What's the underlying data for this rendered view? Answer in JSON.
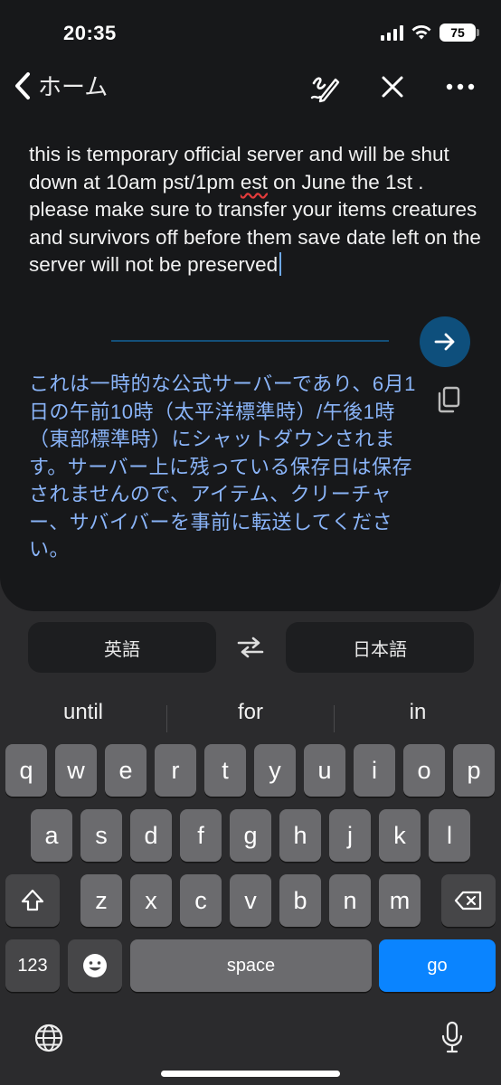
{
  "status_bar": {
    "time": "20:35",
    "battery": "75"
  },
  "nav": {
    "back_label": "ホーム"
  },
  "source": {
    "text_before": "this is temporary official server and will be shut down at 10am pst/1pm ",
    "spell_word": "est",
    "text_after": " on June the 1st . please make sure to transfer your items creatures and survivors off before them save date left on the server will not be preserved"
  },
  "translation": {
    "text": "これは一時的な公式サーバーであり、6月1日の午前10時（太平洋標準時）/午後1時（東部標準時）にシャットダウンされます。サーバー上に残っている保存日は保存されませんので、アイテム、クリーチャー、サバイバーを事前に転送してください。"
  },
  "languages": {
    "source": "英語",
    "target": "日本語"
  },
  "keyboard": {
    "suggestions": [
      "until",
      "for",
      "in"
    ],
    "row1": [
      "q",
      "w",
      "e",
      "r",
      "t",
      "y",
      "u",
      "i",
      "o",
      "p"
    ],
    "row2": [
      "a",
      "s",
      "d",
      "f",
      "g",
      "h",
      "j",
      "k",
      "l"
    ],
    "row3": [
      "z",
      "x",
      "c",
      "v",
      "b",
      "n",
      "m"
    ],
    "numbers_label": "123",
    "space_label": "space",
    "go_label": "go"
  },
  "colors": {
    "accent": "#0a84ff",
    "translation_text": "#8ab4f8",
    "arrow_button": "#0e4f7c"
  },
  "icons": [
    "chevron-left-icon",
    "handwriting-icon",
    "close-icon",
    "more-icon",
    "arrow-right-icon",
    "copy-icon",
    "swap-icon",
    "shift-icon",
    "backspace-icon",
    "emoji-icon",
    "globe-icon",
    "microphone-icon"
  ]
}
